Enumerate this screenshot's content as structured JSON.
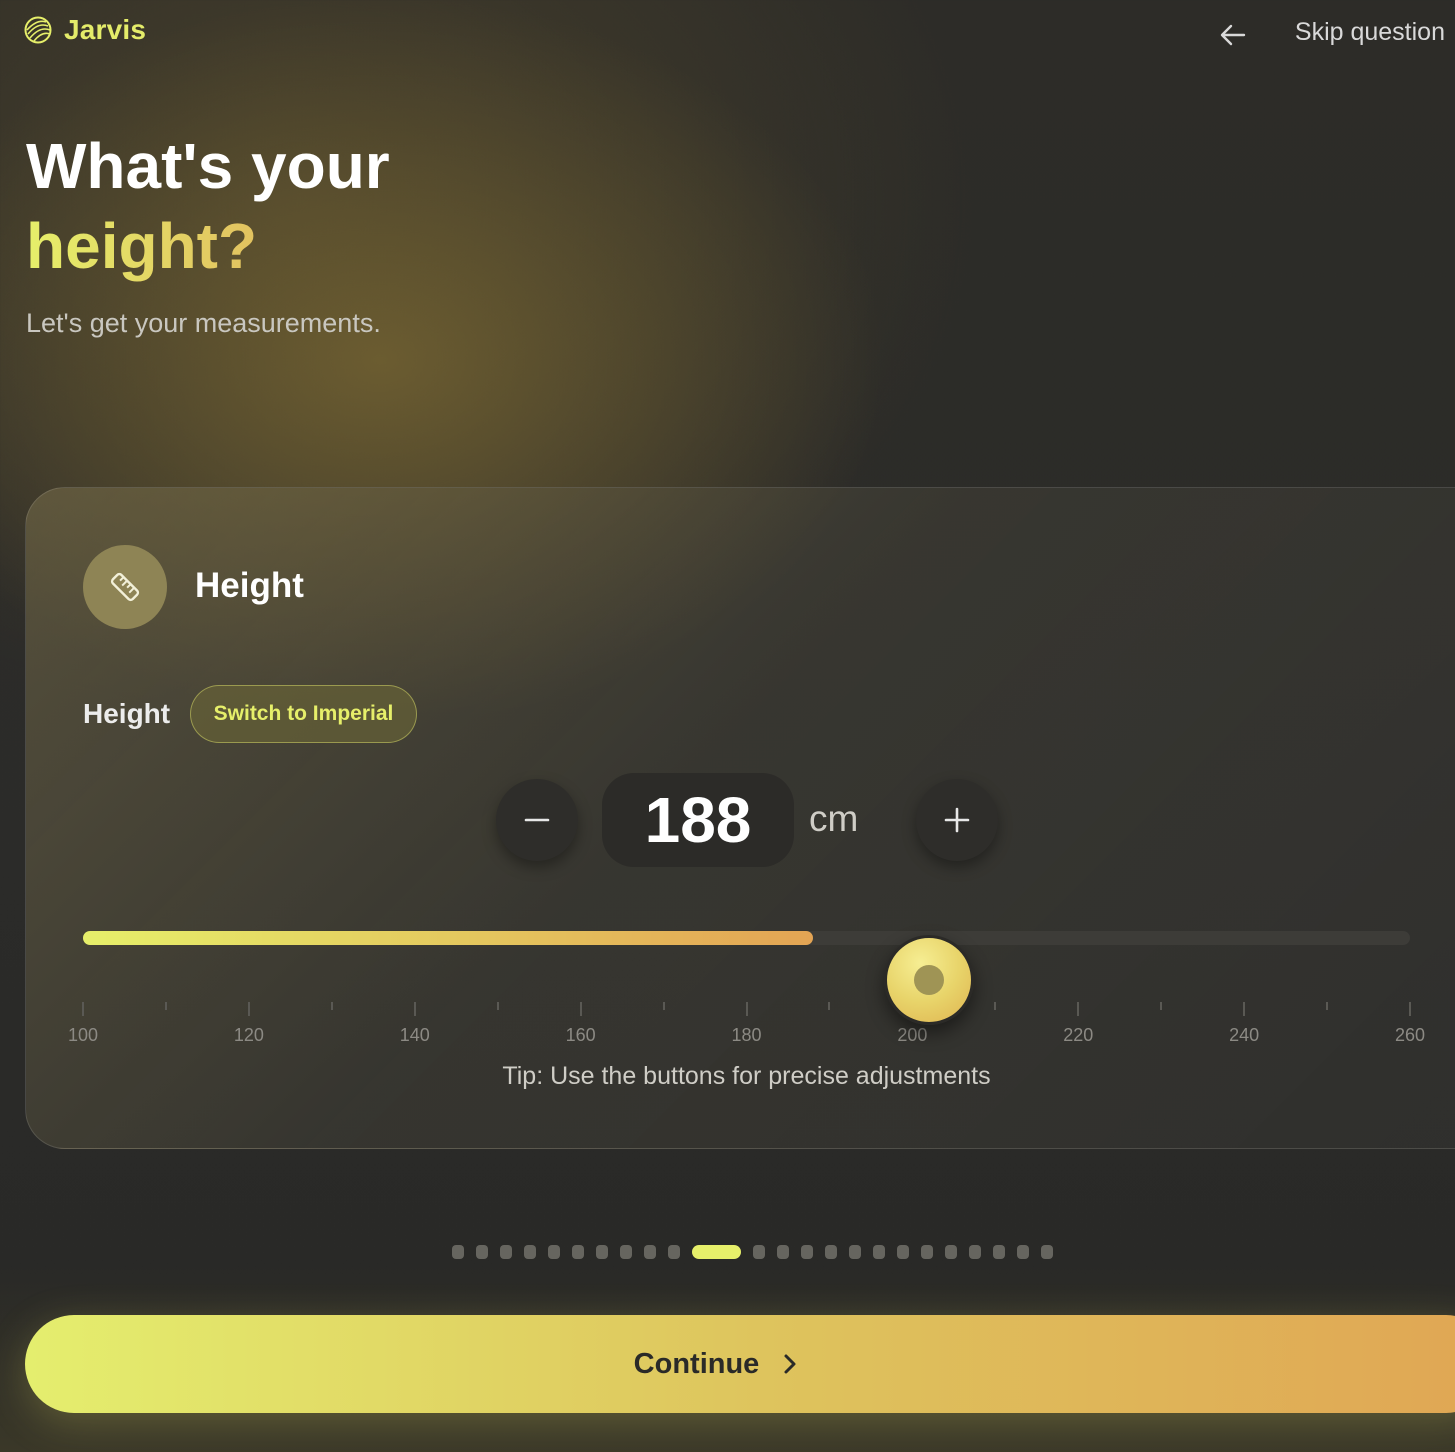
{
  "app": {
    "name": "Jarvis"
  },
  "header": {
    "skip_label": "Skip question"
  },
  "heading": {
    "line1": "What's your",
    "line2": "height?",
    "subtitle": "Let's get your measurements."
  },
  "card": {
    "title": "Height",
    "field_label": "Height",
    "switch_label": "Switch to Imperial",
    "value": "188",
    "unit": "cm",
    "slider": {
      "min": 100,
      "max": 260,
      "fill_value": 188,
      "thumb_value": 202
    },
    "ticks": [
      "100",
      "120",
      "140",
      "160",
      "180",
      "200",
      "220",
      "240",
      "260"
    ],
    "tip": "Tip: Use the buttons for precise adjustments"
  },
  "progress": {
    "total_steps": 24,
    "current_step": 11
  },
  "continue_label": "Continue",
  "colors": {
    "accent_yellow": "#e6ef6a",
    "accent_orange": "#e0a654",
    "background": "#2b2b29"
  },
  "icons": {
    "logo": "yarn-ball-icon",
    "back": "arrow-left-icon",
    "card": "ruler-icon",
    "minus": "minus-icon",
    "plus": "plus-icon",
    "continue": "chevron-right-icon"
  }
}
